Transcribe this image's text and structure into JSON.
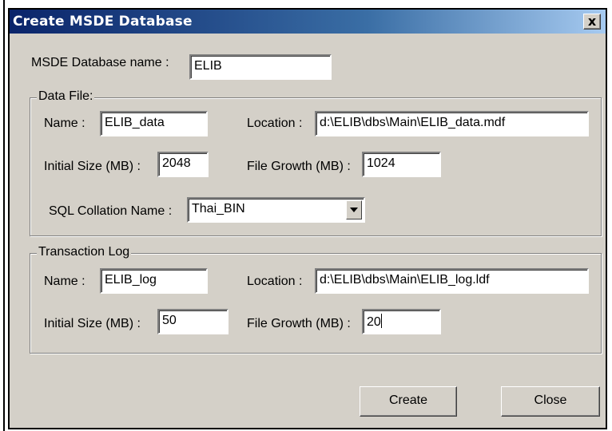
{
  "window": {
    "title": "Create MSDE Database",
    "close_glyph": "x"
  },
  "database": {
    "label": "MSDE Database name :",
    "value": "ELIB"
  },
  "data_file": {
    "group_title": "Data File:",
    "name_label": "Name :",
    "name_value": "ELIB_data",
    "location_label": "Location :",
    "location_value": "d:\\ELIB\\dbs\\Main\\ELIB_data.mdf",
    "initial_size_label": "Initial Size (MB) :",
    "initial_size_value": "2048",
    "file_growth_label": "File Growth (MB) :",
    "file_growth_value": "1024",
    "collation_label": "SQL Collation Name :",
    "collation_value": "Thai_BIN"
  },
  "transaction_log": {
    "group_title": "Transaction Log",
    "name_label": "Name :",
    "name_value": "ELIB_log",
    "location_label": "Location :",
    "location_value": "d:\\ELIB\\dbs\\Main\\ELIB_log.ldf",
    "initial_size_label": "Initial Size (MB) :",
    "initial_size_value": "50",
    "file_growth_label": "File Growth (MB) :",
    "file_growth_value": "20"
  },
  "buttons": {
    "create": "Create",
    "close": "Close"
  },
  "icons": {
    "close": "close-icon",
    "dropdown": "chevron-down-icon"
  }
}
